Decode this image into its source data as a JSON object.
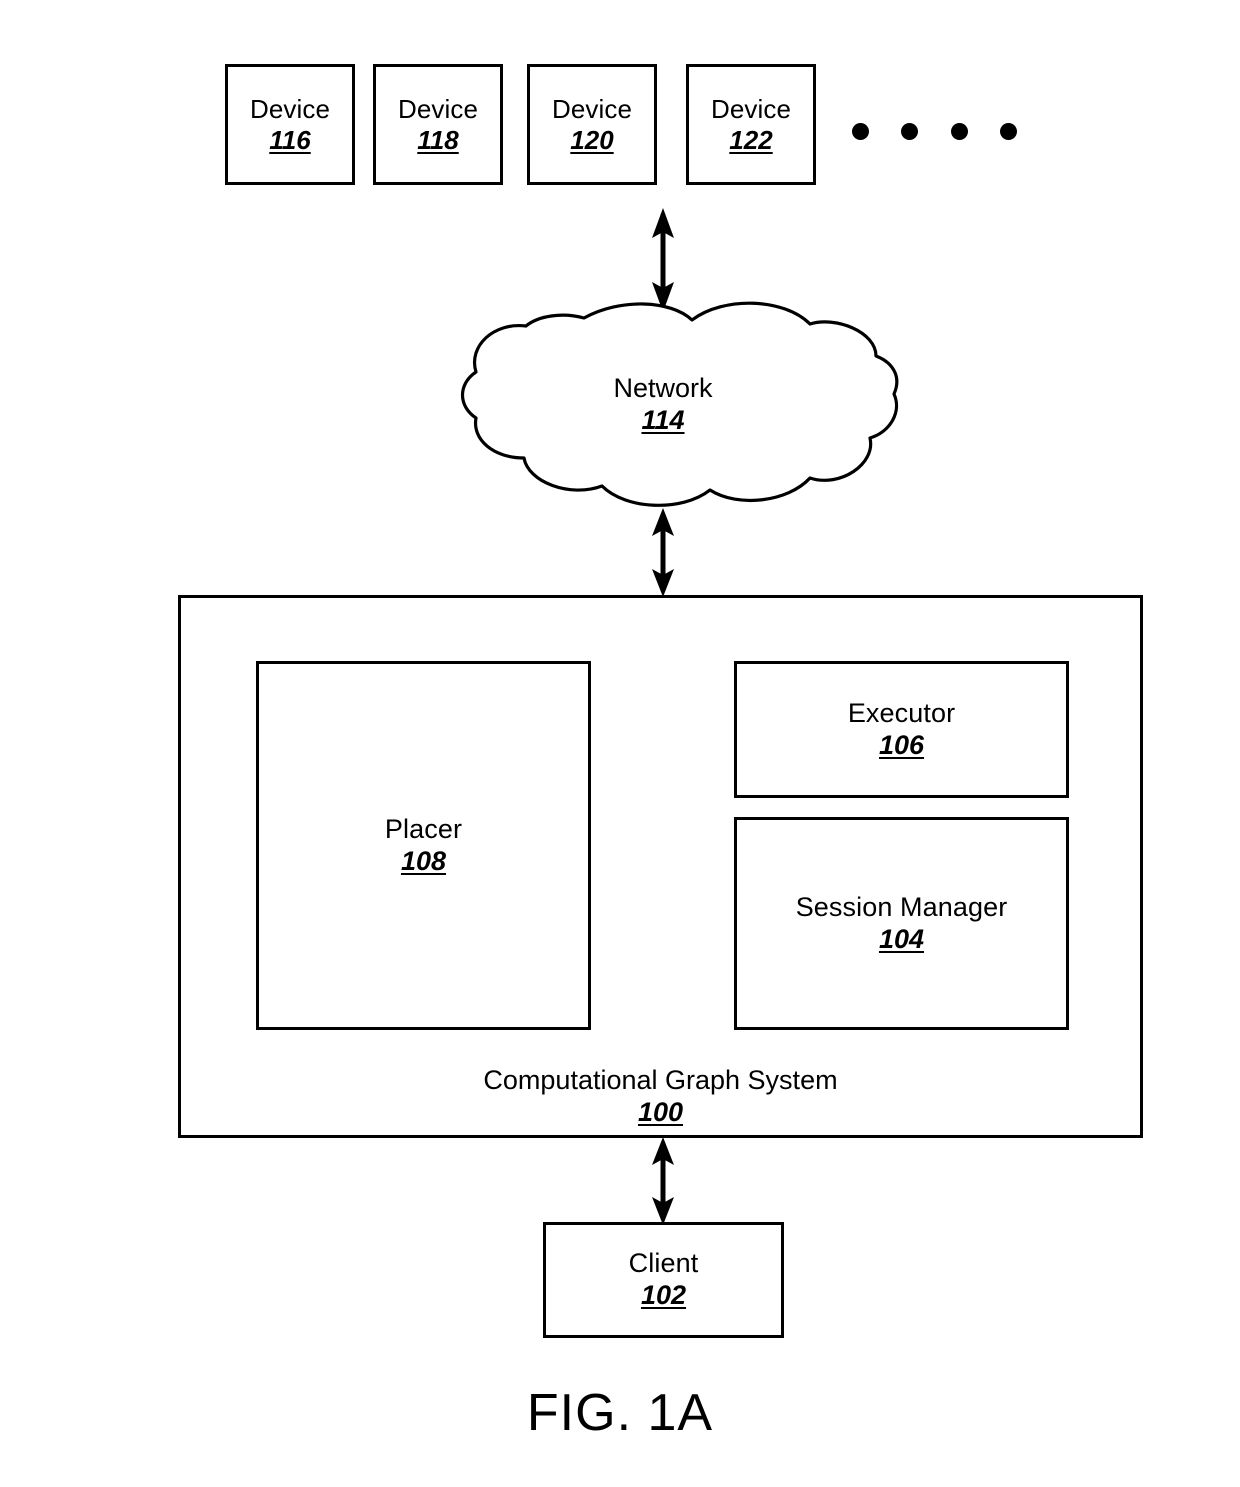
{
  "figure": {
    "caption": "FIG. 1A"
  },
  "devices": [
    {
      "label": "Device",
      "number": "116",
      "icon": "device-box-icon"
    },
    {
      "label": "Device",
      "number": "118",
      "icon": "device-box-icon"
    },
    {
      "label": "Device",
      "number": "120",
      "icon": "device-box-icon"
    },
    {
      "label": "Device",
      "number": "122",
      "icon": "device-box-icon"
    }
  ],
  "ellipsis": {
    "name": "continuation-dots",
    "count": 4
  },
  "network": {
    "label": "Network",
    "number": "114",
    "icon": "cloud-icon"
  },
  "system": {
    "label": "Computational Graph System",
    "number": "100",
    "components": [
      {
        "label": "Placer",
        "number": "108"
      },
      {
        "label": "Executor",
        "number": "106"
      },
      {
        "label": "Session Manager",
        "number": "104"
      }
    ]
  },
  "client": {
    "label": "Client",
    "number": "102"
  },
  "connections": [
    {
      "name": "devices-to-network",
      "style": "double-headed-arrow"
    },
    {
      "name": "network-to-system",
      "style": "double-headed-arrow"
    },
    {
      "name": "system-to-client",
      "style": "double-headed-arrow"
    }
  ],
  "colors": {
    "stroke": "#000000",
    "background": "#ffffff"
  }
}
